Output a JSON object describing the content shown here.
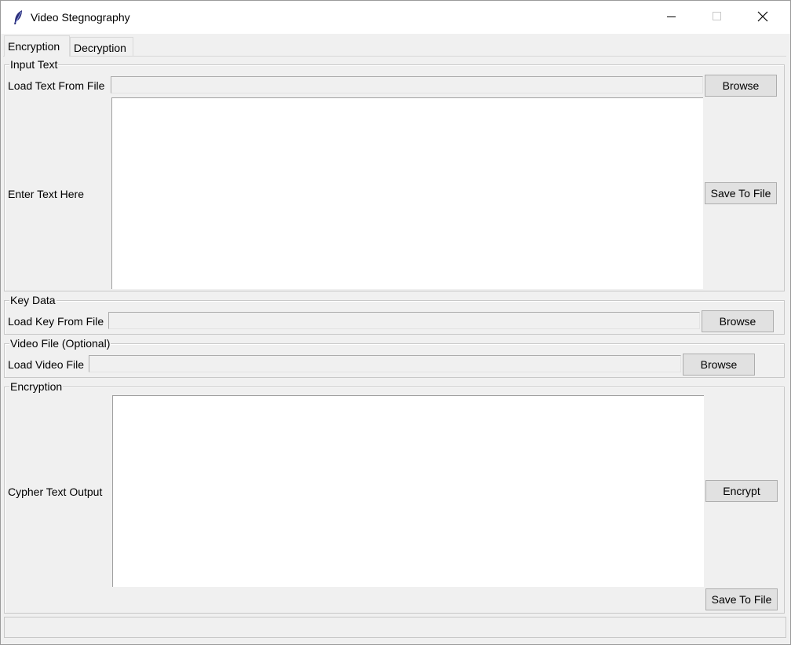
{
  "window": {
    "title": "Video Stegnography",
    "app_icon": "feather-icon",
    "controls": [
      "minimize-icon",
      "maximize-icon",
      "close-icon"
    ]
  },
  "tabs": [
    {
      "label": "Encryption",
      "active": true
    },
    {
      "label": "Decryption",
      "active": false
    }
  ],
  "input_text": {
    "frame_label": "Input Text",
    "load_label": "Load Text From File",
    "load_value": "",
    "browse_label": "Browse",
    "enter_label": "Enter Text Here",
    "text_value": "",
    "save_label": "Save To File"
  },
  "key_data": {
    "frame_label": "Key Data",
    "load_label": "Load Key From File",
    "load_value": "",
    "browse_label": "Browse"
  },
  "video_file": {
    "frame_label": "Video File (Optional)",
    "load_label": "Load Video File",
    "load_value": "",
    "browse_label": "Browse"
  },
  "encryption": {
    "frame_label": "Encryption",
    "output_label": "Cypher Text Output",
    "output_value": "",
    "encrypt_label": "Encrypt",
    "save_label": "Save To File"
  },
  "statusbar": {
    "text": ""
  },
  "colors": {
    "window_bg": "#f0f0f0",
    "titlebar_bg": "#ffffff",
    "button_bg": "#e1e1e1",
    "text_bg": "#ffffff"
  }
}
